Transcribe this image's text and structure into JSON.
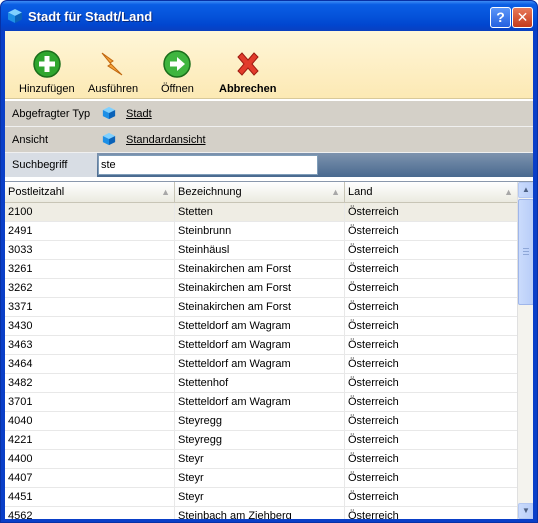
{
  "window": {
    "title": "Stadt für Stadt/Land",
    "help_label": "?",
    "close_label": "✕"
  },
  "toolbar": {
    "add_label": "Hinzufügen",
    "execute_label": "Ausführen",
    "open_label": "Öffnen",
    "cancel_label": "Abbrechen"
  },
  "filters": {
    "type_label": "Abgefragter Typ",
    "type_value": "Stadt",
    "view_label": "Ansicht",
    "view_value": "Standardansicht"
  },
  "search": {
    "label": "Suchbegriff",
    "value": "ste"
  },
  "grid": {
    "columns": [
      "Postleitzahl",
      "Bezeichnung",
      "Land"
    ],
    "rows": [
      [
        "2100",
        "Stetten",
        "Österreich"
      ],
      [
        "2491",
        "Steinbrunn",
        "Österreich"
      ],
      [
        "3033",
        "Steinhäusl",
        "Österreich"
      ],
      [
        "3261",
        "Steinakirchen am Forst",
        "Österreich"
      ],
      [
        "3262",
        "Steinakirchen am Forst",
        "Österreich"
      ],
      [
        "3371",
        "Steinakirchen am Forst",
        "Österreich"
      ],
      [
        "3430",
        "Stetteldorf am Wagram",
        "Österreich"
      ],
      [
        "3463",
        "Stetteldorf am Wagram",
        "Österreich"
      ],
      [
        "3464",
        "Stetteldorf am Wagram",
        "Österreich"
      ],
      [
        "3482",
        "Stettenhof",
        "Österreich"
      ],
      [
        "3701",
        "Stetteldorf am Wagram",
        "Österreich"
      ],
      [
        "4040",
        "Steyregg",
        "Österreich"
      ],
      [
        "4221",
        "Steyregg",
        "Österreich"
      ],
      [
        "4400",
        "Steyr",
        "Österreich"
      ],
      [
        "4407",
        "Steyr",
        "Österreich"
      ],
      [
        "4451",
        "Steyr",
        "Österreich"
      ],
      [
        "4562",
        "Steinbach am Ziehberg",
        "Österreich"
      ]
    ]
  },
  "icons": {
    "window": "cube-icon",
    "add": "plus-circle-icon",
    "execute": "lightning-icon",
    "open": "arrow-right-circle-icon",
    "cancel": "x-icon"
  }
}
